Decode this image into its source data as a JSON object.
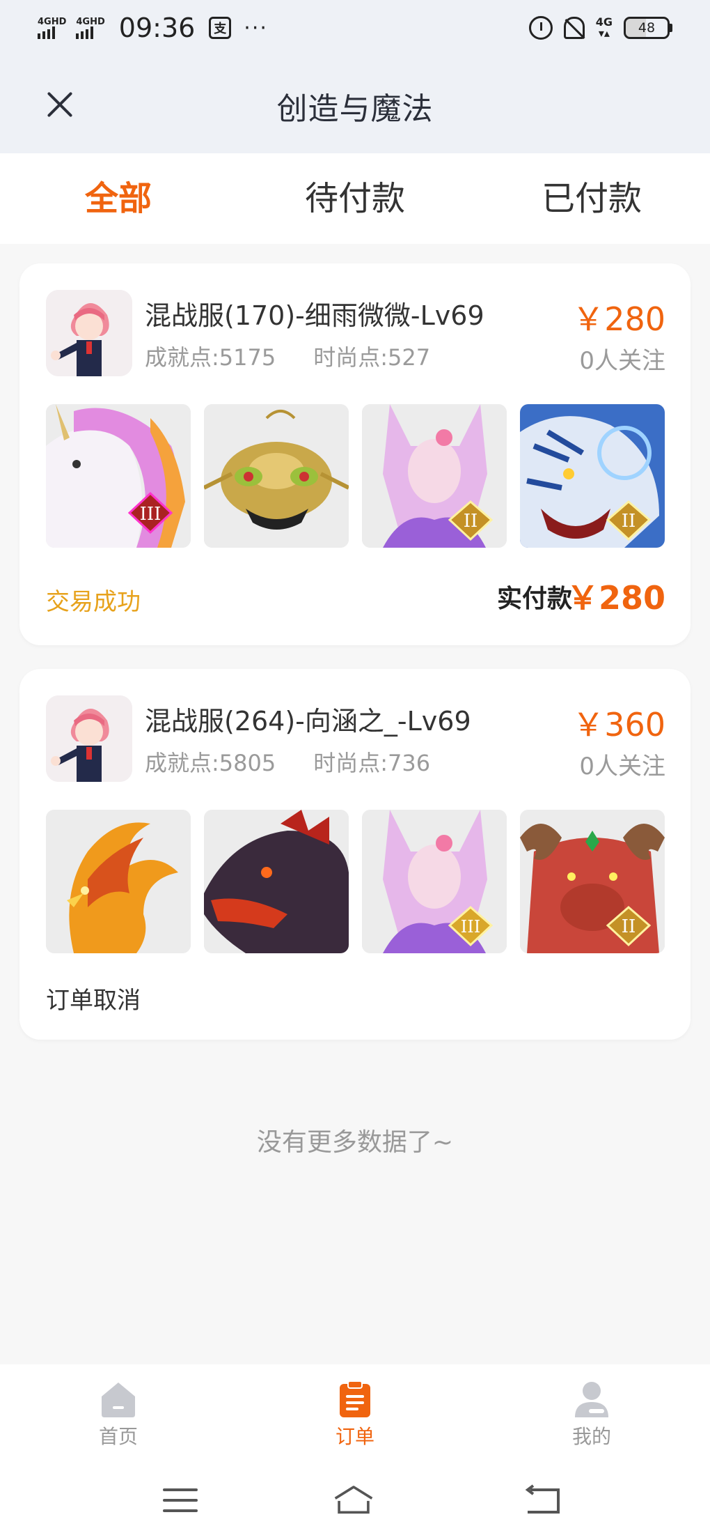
{
  "status_bar": {
    "signal_1": "4GHD",
    "signal_2": "4GHD",
    "time": "09:36",
    "notify_icon": "支",
    "more": "···",
    "network": "4G",
    "battery": "48"
  },
  "header": {
    "title": "创造与魔法",
    "close_icon": "close-icon"
  },
  "tabs": [
    {
      "label": "全部",
      "active": true
    },
    {
      "label": "待付款",
      "active": false
    },
    {
      "label": "已付款",
      "active": false
    }
  ],
  "orders": [
    {
      "name": "混战服(170)-细雨微微-Lv69",
      "achievement": "成就点:5175",
      "fashion": "时尚点:527",
      "price": "￥280",
      "followers": "0人关注",
      "status": "交易成功",
      "status_color": "#e7a21c",
      "paid_label": "实付款",
      "paid_value": "￥280",
      "items": [
        {
          "icon": "unicorn-mount",
          "badge": "III"
        },
        {
          "icon": "golden-mantis-mount",
          "badge": ""
        },
        {
          "icon": "fox-spirit-pet",
          "badge": "II"
        },
        {
          "icon": "white-tiger-mount",
          "badge": "II"
        }
      ]
    },
    {
      "name": "混战服(264)-向涵之_-Lv69",
      "achievement": "成就点:5805",
      "fashion": "时尚点:736",
      "price": "￥360",
      "followers": "0人关注",
      "status": "订单取消",
      "status_color": "#333333",
      "items": [
        {
          "icon": "fire-phoenix-mount",
          "badge": ""
        },
        {
          "icon": "dark-dragon-mount",
          "badge": ""
        },
        {
          "icon": "fox-spirit-pet",
          "badge": "III"
        },
        {
          "icon": "red-ram-beast-mount",
          "badge": "II"
        }
      ]
    }
  ],
  "no_more": "没有更多数据了~",
  "bottom_nav": [
    {
      "label": "首页",
      "icon": "home-icon",
      "active": false
    },
    {
      "label": "订单",
      "icon": "order-icon",
      "active": true
    },
    {
      "label": "我的",
      "icon": "profile-icon",
      "active": false
    }
  ],
  "colors": {
    "accent": "#f0640f",
    "success": "#e7a21c"
  }
}
